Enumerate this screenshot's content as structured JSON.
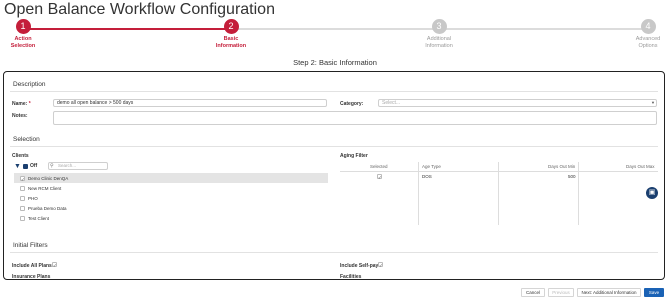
{
  "page": {
    "title": "Open Balance Workflow Configuration",
    "subtitle": "Step 2: Basic Information"
  },
  "stepper": {
    "steps": [
      {
        "number": "1",
        "label_line1": "Action",
        "label_line2": "Selection",
        "state": "active"
      },
      {
        "number": "2",
        "label_line1": "Basic",
        "label_line2": "Information",
        "state": "active"
      },
      {
        "number": "3",
        "label_line1": "Additional",
        "label_line2": "Information",
        "state": "inactive"
      },
      {
        "number": "4",
        "label_line1": "Advanced",
        "label_line2": "Options",
        "state": "inactive"
      }
    ],
    "colors": {
      "active": "#c41e3a",
      "inactive": "#c8c8c8"
    }
  },
  "description": {
    "heading": "Description",
    "name_label": "Name:",
    "name_required_mark": "*",
    "name_value": "demo all open balance > 500 days",
    "category_label": "Category:",
    "category_placeholder": "Select...",
    "notes_label": "Notes:"
  },
  "selection": {
    "heading": "Selection",
    "clients_label": "Clients",
    "filter_toggle": "Off",
    "search_placeholder": "Search...",
    "clients": [
      {
        "name": "Demo Clinic DenQA",
        "checked": true
      },
      {
        "name": "New RCM Client",
        "checked": false
      },
      {
        "name": "PHO",
        "checked": false
      },
      {
        "name": "Prueba Demo Data",
        "checked": false
      },
      {
        "name": "Test Client",
        "checked": false
      }
    ],
    "aging_filter_label": "Aging Filter",
    "aging_columns": [
      "Selected",
      "Age Type",
      "Days Out Min",
      "Days Out Max"
    ],
    "aging_rows": [
      {
        "selected": true,
        "age_type": "DOS",
        "days_out_min": "500",
        "days_out_max": ""
      }
    ]
  },
  "initial_filters": {
    "heading": "Initial Filters",
    "include_all_plans_label": "Include All Plans:",
    "include_all_plans": true,
    "include_self_pay_label": "Include Self-pay:",
    "include_self_pay": true,
    "insurance_plans_label": "Insurance Plans",
    "facilities_label": "Facilities"
  },
  "footer": {
    "cancel": "Cancel",
    "previous": "Previous",
    "next": "Next: Additional Information",
    "save": "Save"
  },
  "colors": {
    "accent": "#c41e3a",
    "primary": "#1a62b5",
    "navy": "#1a3f6f"
  }
}
